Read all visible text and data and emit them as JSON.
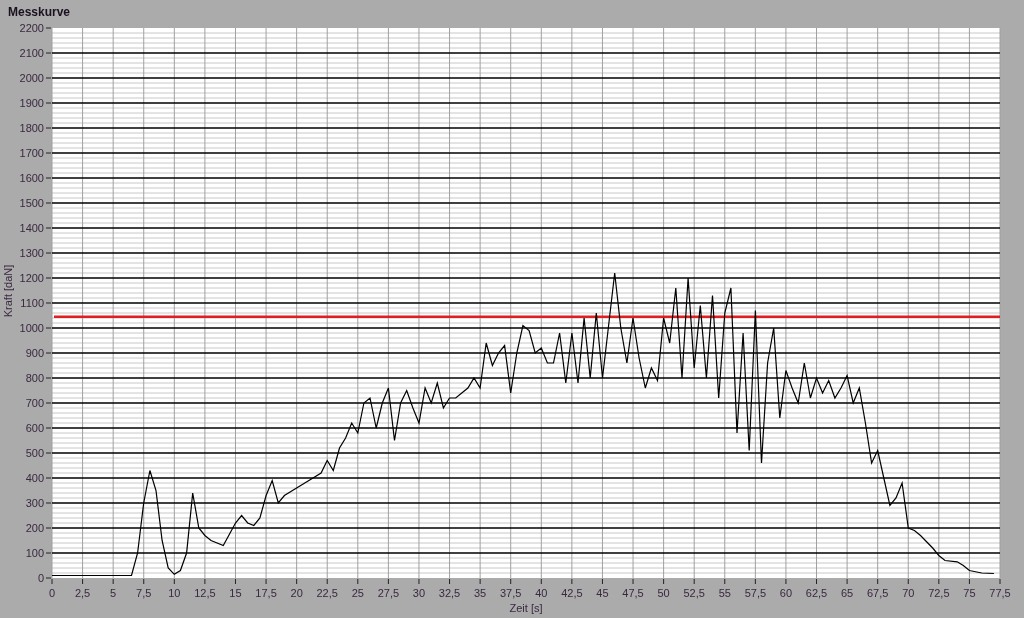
{
  "window": {
    "title": "Messkurve"
  },
  "chart_data": {
    "type": "line",
    "xlabel": "Zeit [s]",
    "ylabel": "Kraft [daN]",
    "xlim": [
      0,
      77.5
    ],
    "ylim": [
      0,
      2200
    ],
    "x": [
      0,
      6.5,
      7,
      7.5,
      8,
      8.5,
      9,
      9.5,
      10,
      10.5,
      11,
      11.5,
      12,
      12.5,
      13,
      14,
      15,
      15.5,
      16,
      16.5,
      17,
      17.5,
      18,
      18.5,
      19,
      20,
      21,
      22,
      22.5,
      23,
      23.5,
      24,
      24.5,
      25,
      25.5,
      26,
      26.5,
      27,
      27.5,
      28,
      28.5,
      29,
      29.5,
      30,
      30.5,
      31,
      31.5,
      32,
      32.5,
      33,
      34,
      34.5,
      35,
      35.5,
      36,
      36.5,
      37,
      37.5,
      38,
      38.5,
      39,
      39.5,
      40,
      40.5,
      41,
      41.5,
      42,
      42.5,
      43,
      43.5,
      44,
      44.5,
      45,
      45.5,
      46,
      46.5,
      47,
      47.5,
      48,
      48.5,
      49,
      49.5,
      50,
      50.5,
      51,
      51.5,
      52,
      52.5,
      53,
      53.5,
      54,
      54.5,
      55,
      55.5,
      56,
      56.5,
      57,
      57.5,
      58,
      58.5,
      59,
      59.5,
      60,
      60.5,
      61,
      61.5,
      62,
      62.5,
      63,
      63.5,
      64,
      64.5,
      65,
      65.5,
      66,
      66.5,
      67,
      67.5,
      68,
      68.5,
      69,
      69.5,
      70,
      70.5,
      71,
      72,
      72.5,
      73,
      74,
      74.5,
      75,
      76,
      77
    ],
    "series": [
      {
        "color": "#000000",
        "values": [
          10,
          10,
          100,
          300,
          430,
          350,
          150,
          40,
          15,
          30,
          100,
          340,
          200,
          170,
          150,
          130,
          220,
          250,
          220,
          210,
          240,
          330,
          390,
          300,
          330,
          360,
          390,
          420,
          470,
          430,
          520,
          560,
          620,
          580,
          700,
          720,
          600,
          700,
          760,
          550,
          700,
          750,
          680,
          620,
          760,
          700,
          780,
          680,
          720,
          720,
          760,
          800,
          760,
          940,
          850,
          900,
          930,
          740,
          900,
          1010,
          990,
          900,
          920,
          860,
          860,
          980,
          780,
          980,
          780,
          1040,
          800,
          1060,
          800,
          1010,
          1220,
          1000,
          860,
          1040,
          880,
          760,
          840,
          790,
          1040,
          940,
          1160,
          800,
          1200,
          840,
          1090,
          800,
          1130,
          720,
          1060,
          1160,
          580,
          980,
          510,
          1070,
          460,
          860,
          1000,
          640,
          830,
          760,
          700,
          860,
          720,
          800,
          740,
          790,
          720,
          760,
          810,
          700,
          760,
          620,
          460,
          510,
          400,
          290,
          320,
          380,
          200,
          190,
          170,
          120,
          90,
          70,
          65,
          50,
          30,
          20,
          18
        ]
      }
    ],
    "xticks": [
      0,
      {
        "value": 2.5,
        "label": "2,5"
      },
      5,
      {
        "value": 7.5,
        "label": "7,5"
      },
      10,
      {
        "value": 12.5,
        "label": "12,5"
      },
      15,
      {
        "value": 17.5,
        "label": "17,5"
      },
      20,
      {
        "value": 22.5,
        "label": "22,5"
      },
      25,
      {
        "value": 27.5,
        "label": "27,5"
      },
      30,
      {
        "value": 32.5,
        "label": "32,5"
      },
      35,
      {
        "value": 37.5,
        "label": "37,5"
      },
      40,
      {
        "value": 42.5,
        "label": "42,5"
      },
      45,
      {
        "value": 47.5,
        "label": "47,5"
      },
      50,
      {
        "value": 52.5,
        "label": "52,5"
      },
      55,
      {
        "value": 57.5,
        "label": "57,5"
      },
      60,
      {
        "value": 62.5,
        "label": "62,5"
      },
      65,
      {
        "value": 67.5,
        "label": "67,5"
      },
      70,
      {
        "value": 72.5,
        "label": "72,5"
      },
      75,
      {
        "value": 77.5,
        "label": "77,5"
      }
    ],
    "yticks": [
      0,
      100,
      200,
      300,
      400,
      500,
      600,
      700,
      800,
      900,
      1000,
      1100,
      1200,
      1300,
      1400,
      1500,
      1600,
      1700,
      1800,
      1900,
      2000,
      2100,
      2200
    ],
    "grid": true,
    "ref_lines": [
      {
        "axis": "y",
        "value": 1045,
        "color": "#e02020"
      }
    ]
  }
}
